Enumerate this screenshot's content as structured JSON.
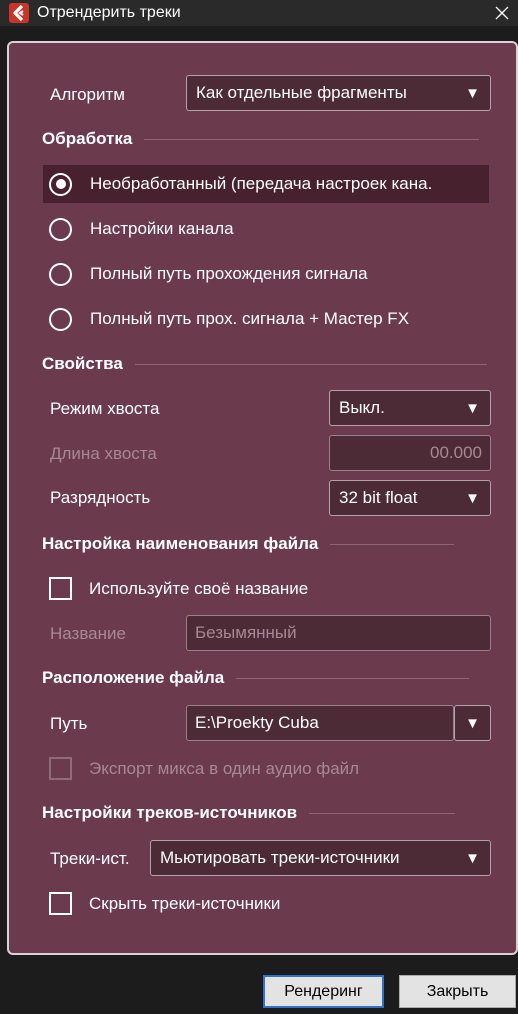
{
  "window": {
    "title": "Отрендерить треки",
    "close_glyph": "✕"
  },
  "algorithm": {
    "label": "Алгоритм",
    "value": "Как отдельные фрагменты"
  },
  "processing": {
    "heading": "Обработка",
    "options": [
      {
        "label": "Необработанный (передача настроек кана.",
        "selected": true
      },
      {
        "label": "Настройки канала",
        "selected": false
      },
      {
        "label": "Полный путь прохождения сигнала",
        "selected": false
      },
      {
        "label": "Полный путь прох. сигнала + Мастер FX",
        "selected": false
      }
    ]
  },
  "properties": {
    "heading": "Свойства",
    "tail_mode": {
      "label": "Режим хвоста",
      "value": "Выкл."
    },
    "tail_length": {
      "label": "Длина хвоста",
      "value": "00.000"
    },
    "bit_depth": {
      "label": "Разрядность",
      "value": "32 bit float"
    }
  },
  "naming": {
    "heading": "Настройка наименования файла",
    "use_own_name": {
      "label": "Используйте своё название",
      "checked": false
    },
    "name": {
      "label": "Название",
      "value": "Безымянный"
    }
  },
  "location": {
    "heading": "Расположение файла",
    "path": {
      "label": "Путь",
      "value": "E:\\Proekty Cuba"
    },
    "export_mix": {
      "label": "Экспорт микса в один аудио файл",
      "checked": false,
      "enabled": false
    }
  },
  "source_tracks": {
    "heading": "Настройки треков-источников",
    "action": {
      "label": "Треки-ист.",
      "value": "Мьютировать треки-источники"
    },
    "hide": {
      "label": "Скрыть треки-источники",
      "checked": false
    }
  },
  "buttons": {
    "render": "Рендеринг",
    "close": "Закрыть"
  },
  "colors": {
    "panel": "#6b3a4d",
    "field": "#4c2a36",
    "accent": "#2f73c8",
    "brand": "#c7362b"
  }
}
